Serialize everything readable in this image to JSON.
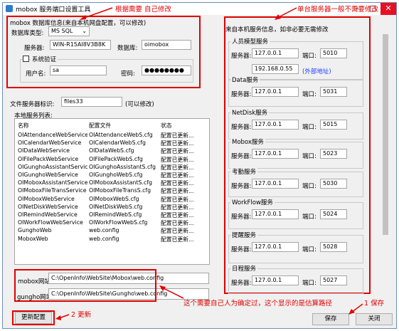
{
  "window": {
    "title": "mobox 服务端口设置工具"
  },
  "annotations": {
    "top_left": "根据需要 自己修改",
    "top_right": "单台服务器一般不需要修改",
    "config_paths": "这个需要自己人为确定过，这个显示的是估算路径",
    "update": "2 更新",
    "save": "1 保存"
  },
  "db_section": {
    "heading": "mobox 数据库信息(来自本机网盘配置，可以修改)",
    "db_type_label": "数据库类型:",
    "db_type_value": "MS SQL",
    "server_label": "服务器:",
    "server_value": "WIN-R15AI8V3B8K",
    "database_label": "数据库:",
    "database_value": "oimobox",
    "system_auth_label": "系统验证",
    "username_label": "用户名:",
    "username_value": "sa",
    "password_label": "密码:",
    "password_value": "●●●●●●●●"
  },
  "file_server": {
    "label": "文件服务器标识:",
    "value": "files33",
    "note": "(可以修改)"
  },
  "local_services": {
    "heading": "本地服务列表:",
    "columns": [
      "名称",
      "配置文件",
      "状态"
    ],
    "rows": [
      [
        "OIAttendanceWebService",
        "OIAttendanceWebS.cfg",
        "配置已更新..."
      ],
      [
        "OICalendarWebService",
        "OICalendarWebS.cfg",
        "配置已更新..."
      ],
      [
        "OIDataWebService",
        "OIDataWebS.cfg",
        "配置已更新..."
      ],
      [
        "OIFilePackWebService",
        "OIFilePackWebS.cfg",
        "配置已更新..."
      ],
      [
        "OIGunghoAssistantService",
        "OIGunghoAssistantS.cfg",
        "配置已更新..."
      ],
      [
        "OIGunghoWebService",
        "OIGunghoWebS.cfg",
        "配置已更新..."
      ],
      [
        "OIMoboxAssistantService",
        "OIMoboxAssistantS.cfg",
        "配置已更新..."
      ],
      [
        "OIMoboxFileTransService",
        "OIMoboxFileTransS.cfg",
        "配置已更新..."
      ],
      [
        "OIMoboxWebService",
        "OIMoboxWebS.cfg",
        "配置已更新..."
      ],
      [
        "OINetDiskWebService",
        "OINetDiskWebS.cfg",
        "配置已更新..."
      ],
      [
        "OIRemindWebService",
        "OIRemindWebS.cfg",
        "配置已更新..."
      ],
      [
        "OIWorkFlowWebService",
        "OIWorkFlowWebS.cfg",
        "配置已更新..."
      ],
      [
        "GunghoWeb",
        "web.config",
        "配置已更新..."
      ],
      [
        "MoboxWeb",
        "web.config",
        "配置已更新..."
      ]
    ]
  },
  "config_paths": {
    "mobox_label": "mobox网站",
    "mobox_value": "C:\\OpenInfo\\WebSite\\Mobox\\web.config",
    "gungho_label": "gungho网站",
    "gungho_value": "C:\\OpenInfo\\WebSite\\Gungho\\web.config"
  },
  "right_panel": {
    "heading": "来自本机服务信息，如非必要无需修改",
    "server_label": "服务器:",
    "port_label": "端口:",
    "extra_address": "192.168.0.55",
    "extra_note": "(外部地址)",
    "services": [
      {
        "title": "人员模型服务",
        "server": "127.0.0.1",
        "port": "5010"
      },
      {
        "title": "Data服务",
        "server": "127.0.0.1",
        "port": "5031"
      },
      {
        "title": "NetDisk服务",
        "server": "127.0.0.1",
        "port": "5015"
      },
      {
        "title": "Mobox服务",
        "server": "127.0.0.1",
        "port": "5023"
      },
      {
        "title": "考勤服务",
        "server": "127.0.0.1",
        "port": "5030"
      },
      {
        "title": "WorkFlow服务",
        "server": "127.0.0.1",
        "port": "5024"
      },
      {
        "title": "提醒服务",
        "server": "127.0.0.1",
        "port": "5028"
      },
      {
        "title": "日程服务",
        "server": "127.0.0.1",
        "port": "5027"
      }
    ]
  },
  "buttons": {
    "update": "更新配置",
    "save": "保存",
    "close": "关闭"
  },
  "colors": {
    "annotation": "#e00000",
    "accent": "#2f7dc8"
  }
}
